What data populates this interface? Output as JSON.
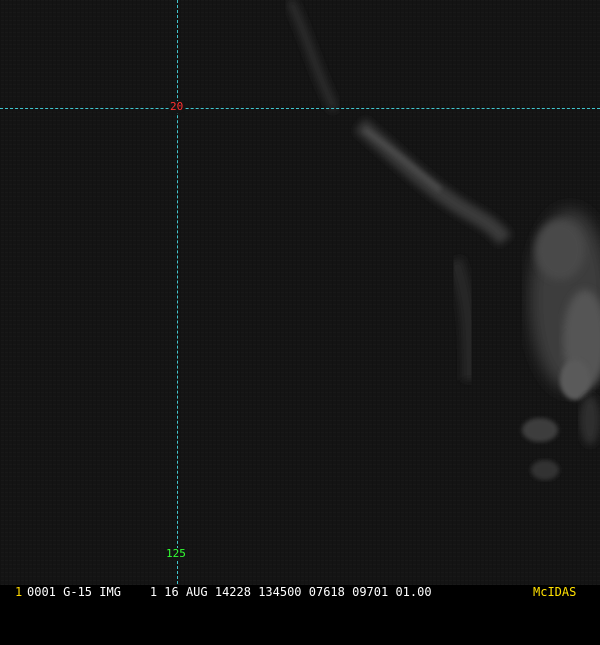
{
  "colors": {
    "background": "#141414",
    "gridline": "#41c6cf",
    "latitude_label": "#ff3030",
    "longitude_label": "#33ff33",
    "frame_number": "#ffd800",
    "status_text": "#ffffff",
    "brand": "#ffe000"
  },
  "gridlines": {
    "latitude_label": "20",
    "longitude_label": "125"
  },
  "status_bar": {
    "frame_number": "1",
    "text": "0001 G-15 IMG    1 16 AUG 14228 134500 07618 09701 01.00",
    "brand": "McIDAS"
  }
}
